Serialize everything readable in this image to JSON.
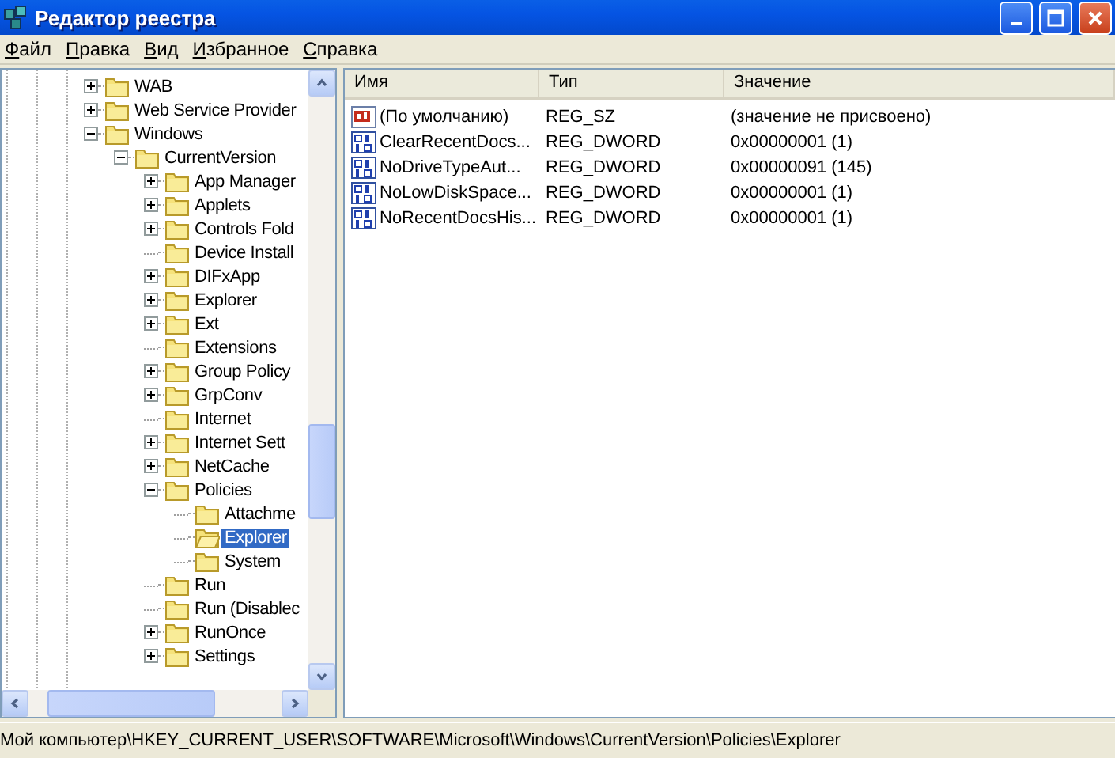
{
  "window": {
    "title": "Редактор реестра"
  },
  "menu": [
    "Файл",
    "Правка",
    "Вид",
    "Избранное",
    "Справка"
  ],
  "tree": [
    {
      "label": "WAB",
      "kind": "collapsed",
      "selected": false
    },
    {
      "label": "Web Service Provider",
      "kind": "collapsed",
      "selected": false
    },
    {
      "label": "Windows",
      "kind": "expanded",
      "selected": false,
      "children": [
        {
          "label": "CurrentVersion",
          "kind": "expanded",
          "selected": false,
          "children": [
            {
              "label": "App Manager",
              "kind": "collapsed",
              "selected": false
            },
            {
              "label": "Applets",
              "kind": "collapsed",
              "selected": false
            },
            {
              "label": "Controls Fold",
              "kind": "collapsed",
              "selected": false
            },
            {
              "label": "Device Install",
              "kind": "leaf",
              "selected": false
            },
            {
              "label": "DIFxApp",
              "kind": "collapsed",
              "selected": false
            },
            {
              "label": "Explorer",
              "kind": "collapsed",
              "selected": false
            },
            {
              "label": "Ext",
              "kind": "collapsed",
              "selected": false
            },
            {
              "label": "Extensions",
              "kind": "leaf",
              "selected": false
            },
            {
              "label": "Group Policy",
              "kind": "collapsed",
              "selected": false
            },
            {
              "label": "GrpConv",
              "kind": "collapsed",
              "selected": false
            },
            {
              "label": "Internet",
              "kind": "leaf",
              "selected": false
            },
            {
              "label": "Internet Sett",
              "kind": "collapsed",
              "selected": false
            },
            {
              "label": "NetCache",
              "kind": "collapsed",
              "selected": false
            },
            {
              "label": "Policies",
              "kind": "expanded",
              "selected": false,
              "children": [
                {
                  "label": "Attachme",
                  "kind": "leaf",
                  "selected": false
                },
                {
                  "label": "Explorer",
                  "kind": "leaf",
                  "selected": true
                },
                {
                  "label": "System",
                  "kind": "leaf",
                  "selected": false
                }
              ]
            },
            {
              "label": "Run",
              "kind": "leaf",
              "selected": false
            },
            {
              "label": "Run (Disablec",
              "kind": "leaf",
              "selected": false
            },
            {
              "label": "RunOnce",
              "kind": "collapsed",
              "selected": false
            },
            {
              "label": "Settings",
              "kind": "collapsed",
              "selected": false
            }
          ]
        }
      ]
    }
  ],
  "columns": [
    "Имя",
    "Тип",
    "Значение"
  ],
  "values": [
    {
      "kind": "string",
      "name": "(По умолчанию)",
      "type": "REG_SZ",
      "data": "(значение не присвоено)"
    },
    {
      "kind": "binary",
      "name": "ClearRecentDocs...",
      "type": "REG_DWORD",
      "data": "0x00000001 (1)"
    },
    {
      "kind": "binary",
      "name": "NoDriveTypeAut...",
      "type": "REG_DWORD",
      "data": "0x00000091 (145)"
    },
    {
      "kind": "binary",
      "name": "NoLowDiskSpace...",
      "type": "REG_DWORD",
      "data": "0x00000001 (1)"
    },
    {
      "kind": "binary",
      "name": "NoRecentDocsHis...",
      "type": "REG_DWORD",
      "data": "0x00000001 (1)"
    }
  ],
  "status_bar": "Мой компьютер\\HKEY_CURRENT_USER\\SOFTWARE\\Microsoft\\Windows\\CurrentVersion\\Policies\\Explorer"
}
